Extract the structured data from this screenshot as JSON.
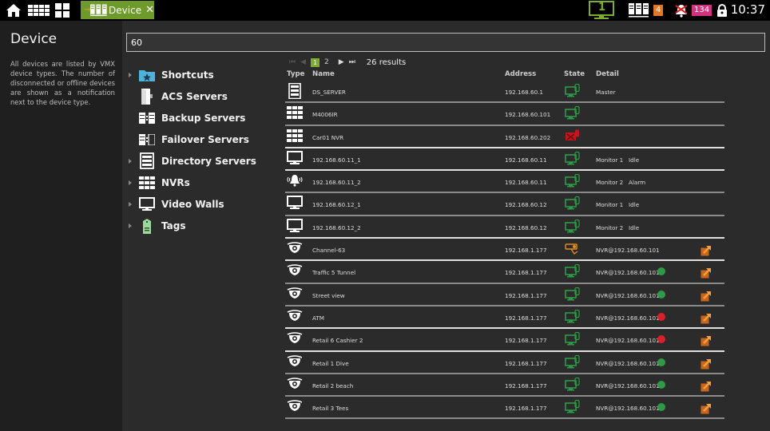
{
  "topbar": {
    "icons": [
      "home-icon",
      "video-wall-icon",
      "layout-grid-icon"
    ],
    "active_tab": {
      "label": "Device",
      "icon": "device-server-icon",
      "close": "✕"
    },
    "monitor_number": "1",
    "device_alert_count": "4",
    "alarm_count": "134",
    "clock": "10:37"
  },
  "left_panel": {
    "title": "Device",
    "description": "All devices are listed by VMX device types. The number of disconnected or offline devices are shown as a notification next to the device type."
  },
  "search": {
    "value": "60"
  },
  "tree": [
    {
      "label": "Shortcuts",
      "icon": "folder-star-icon",
      "expandable": true
    },
    {
      "label": "ACS Servers",
      "icon": "door-icon",
      "expandable": false
    },
    {
      "label": "Backup Servers",
      "icon": "backup-server-icon",
      "expandable": false
    },
    {
      "label": "Failover Servers",
      "icon": "failover-server-icon",
      "expandable": false
    },
    {
      "label": "Directory Servers",
      "icon": "directory-server-icon",
      "expandable": true
    },
    {
      "label": "NVRs",
      "icon": "nvr-icon",
      "expandable": true
    },
    {
      "label": "Video Walls",
      "icon": "monitor-icon",
      "expandable": true
    },
    {
      "label": "Tags",
      "icon": "tag-icon",
      "expandable": true
    }
  ],
  "pager": {
    "pages": [
      "1",
      "2"
    ],
    "current": "1",
    "results": "26 results"
  },
  "columns": {
    "type": "Type",
    "name": "Name",
    "address": "Address",
    "state": "State",
    "detail": "Detail"
  },
  "colors": {
    "accent": "#7dad2d",
    "online": "#2e9a47",
    "offline": "#d9202a",
    "warning": "#e58a1f",
    "badge_orange": "#e0782a",
    "badge_pink": "#d4317f"
  },
  "rows": [
    {
      "type": "server",
      "name": "DS_SERVER",
      "address": "192.168.60.1",
      "state": "online",
      "detail": "Master",
      "dot": "",
      "ext": false
    },
    {
      "type": "nvr",
      "name": "M4006IR",
      "address": "192.168.60.101",
      "state": "online",
      "detail": "",
      "dot": "",
      "ext": false
    },
    {
      "type": "nvr",
      "name": "Car01 NVR",
      "address": "192.168.60.202",
      "state": "offline",
      "detail": "",
      "dot": "",
      "ext": false
    },
    {
      "type": "monitor",
      "name": "192.168.60.11_1",
      "address": "192.168.60.11",
      "state": "online",
      "detail": "Monitor 1   Idle",
      "dot": "",
      "ext": false
    },
    {
      "type": "alarm",
      "name": "192.168.60.11_2",
      "address": "192.168.60.11",
      "state": "online",
      "detail": "Monitor 2   Alarm",
      "dot": "",
      "ext": false
    },
    {
      "type": "monitor",
      "name": "192.168.60.12_1",
      "address": "192.168.60.12",
      "state": "online",
      "detail": "Monitor 1   Idle",
      "dot": "",
      "ext": false
    },
    {
      "type": "monitor",
      "name": "192.168.60.12_2",
      "address": "192.168.60.12",
      "state": "online",
      "detail": "Monitor 2   Idle",
      "dot": "",
      "ext": false
    },
    {
      "type": "camera",
      "name": "Channel-63",
      "address": "192.168.1.177",
      "state": "camera-warning",
      "detail": "NVR@192.168.60.101",
      "dot": "",
      "ext": true
    },
    {
      "type": "camera",
      "name": "Traffic 5 Tunnel",
      "address": "192.168.1.177",
      "state": "online",
      "detail": "NVR@192.168.60.101",
      "dot": "green",
      "ext": true
    },
    {
      "type": "camera",
      "name": "Street view",
      "address": "192.168.1.177",
      "state": "online",
      "detail": "NVR@192.168.60.101",
      "dot": "green",
      "ext": true
    },
    {
      "type": "camera",
      "name": "ATM",
      "address": "192.168.1.177",
      "state": "online",
      "detail": "NVR@192.168.60.101",
      "dot": "red",
      "ext": true
    },
    {
      "type": "camera",
      "name": "Retail 6 Cashier 2",
      "address": "192.168.1.177",
      "state": "online",
      "detail": "NVR@192.168.60.101",
      "dot": "red",
      "ext": true
    },
    {
      "type": "camera",
      "name": "Retail 1 Dive",
      "address": "192.168.1.177",
      "state": "online",
      "detail": "NVR@192.168.60.101",
      "dot": "green",
      "ext": true
    },
    {
      "type": "camera",
      "name": "Retail 2 beach",
      "address": "192.168.1.177",
      "state": "online",
      "detail": "NVR@192.168.60.101",
      "dot": "green",
      "ext": true
    },
    {
      "type": "camera",
      "name": "Retail 3 Tees",
      "address": "192.168.1.177",
      "state": "online",
      "detail": "NVR@192.168.60.101",
      "dot": "green",
      "ext": true
    }
  ]
}
